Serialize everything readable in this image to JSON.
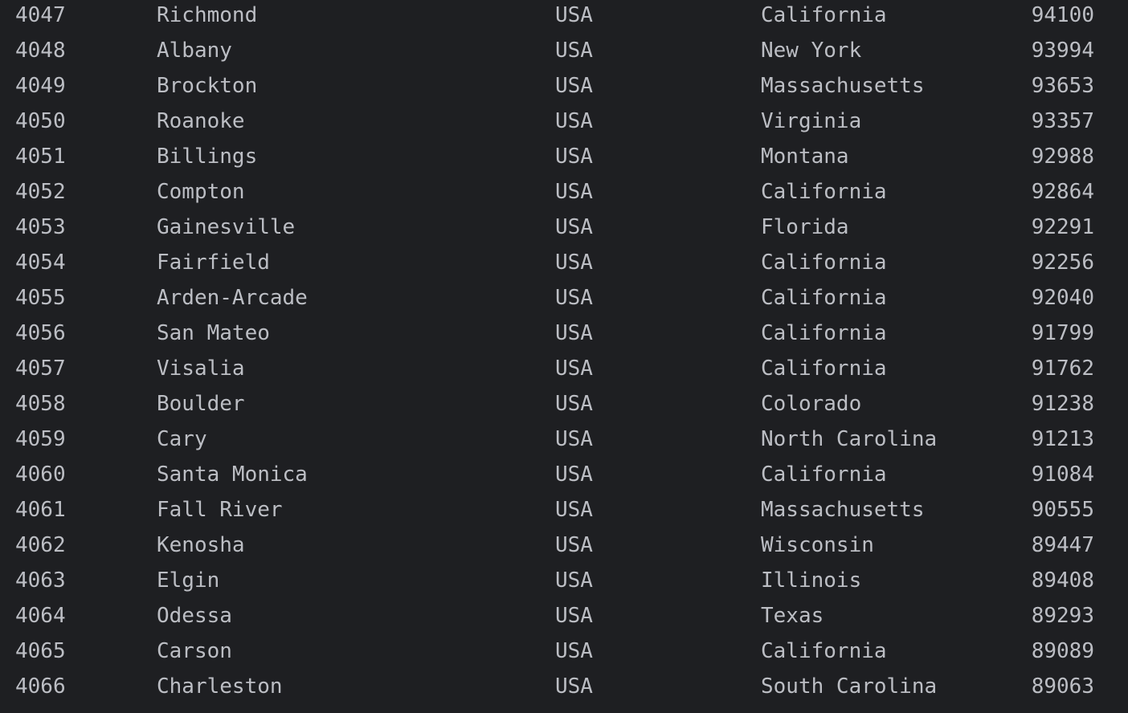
{
  "rows": [
    {
      "id": "4047",
      "city": "Richmond",
      "country": "USA",
      "state": "California",
      "population": "94100"
    },
    {
      "id": "4048",
      "city": "Albany",
      "country": "USA",
      "state": "New York",
      "population": "93994"
    },
    {
      "id": "4049",
      "city": "Brockton",
      "country": "USA",
      "state": "Massachusetts",
      "population": "93653"
    },
    {
      "id": "4050",
      "city": "Roanoke",
      "country": "USA",
      "state": "Virginia",
      "population": "93357"
    },
    {
      "id": "4051",
      "city": "Billings",
      "country": "USA",
      "state": "Montana",
      "population": "92988"
    },
    {
      "id": "4052",
      "city": "Compton",
      "country": "USA",
      "state": "California",
      "population": "92864"
    },
    {
      "id": "4053",
      "city": "Gainesville",
      "country": "USA",
      "state": "Florida",
      "population": "92291"
    },
    {
      "id": "4054",
      "city": "Fairfield",
      "country": "USA",
      "state": "California",
      "population": "92256"
    },
    {
      "id": "4055",
      "city": "Arden-Arcade",
      "country": "USA",
      "state": "California",
      "population": "92040"
    },
    {
      "id": "4056",
      "city": "San Mateo",
      "country": "USA",
      "state": "California",
      "population": "91799"
    },
    {
      "id": "4057",
      "city": "Visalia",
      "country": "USA",
      "state": "California",
      "population": "91762"
    },
    {
      "id": "4058",
      "city": "Boulder",
      "country": "USA",
      "state": "Colorado",
      "population": "91238"
    },
    {
      "id": "4059",
      "city": "Cary",
      "country": "USA",
      "state": "North Carolina",
      "population": "91213"
    },
    {
      "id": "4060",
      "city": "Santa Monica",
      "country": "USA",
      "state": "California",
      "population": "91084"
    },
    {
      "id": "4061",
      "city": "Fall River",
      "country": "USA",
      "state": "Massachusetts",
      "population": "90555"
    },
    {
      "id": "4062",
      "city": "Kenosha",
      "country": "USA",
      "state": "Wisconsin",
      "population": "89447"
    },
    {
      "id": "4063",
      "city": "Elgin",
      "country": "USA",
      "state": "Illinois",
      "population": "89408"
    },
    {
      "id": "4064",
      "city": "Odessa",
      "country": "USA",
      "state": "Texas",
      "population": "89293"
    },
    {
      "id": "4065",
      "city": "Carson",
      "country": "USA",
      "state": "California",
      "population": "89089"
    },
    {
      "id": "4066",
      "city": "Charleston",
      "country": "USA",
      "state": "South Carolina",
      "population": "89063"
    }
  ]
}
